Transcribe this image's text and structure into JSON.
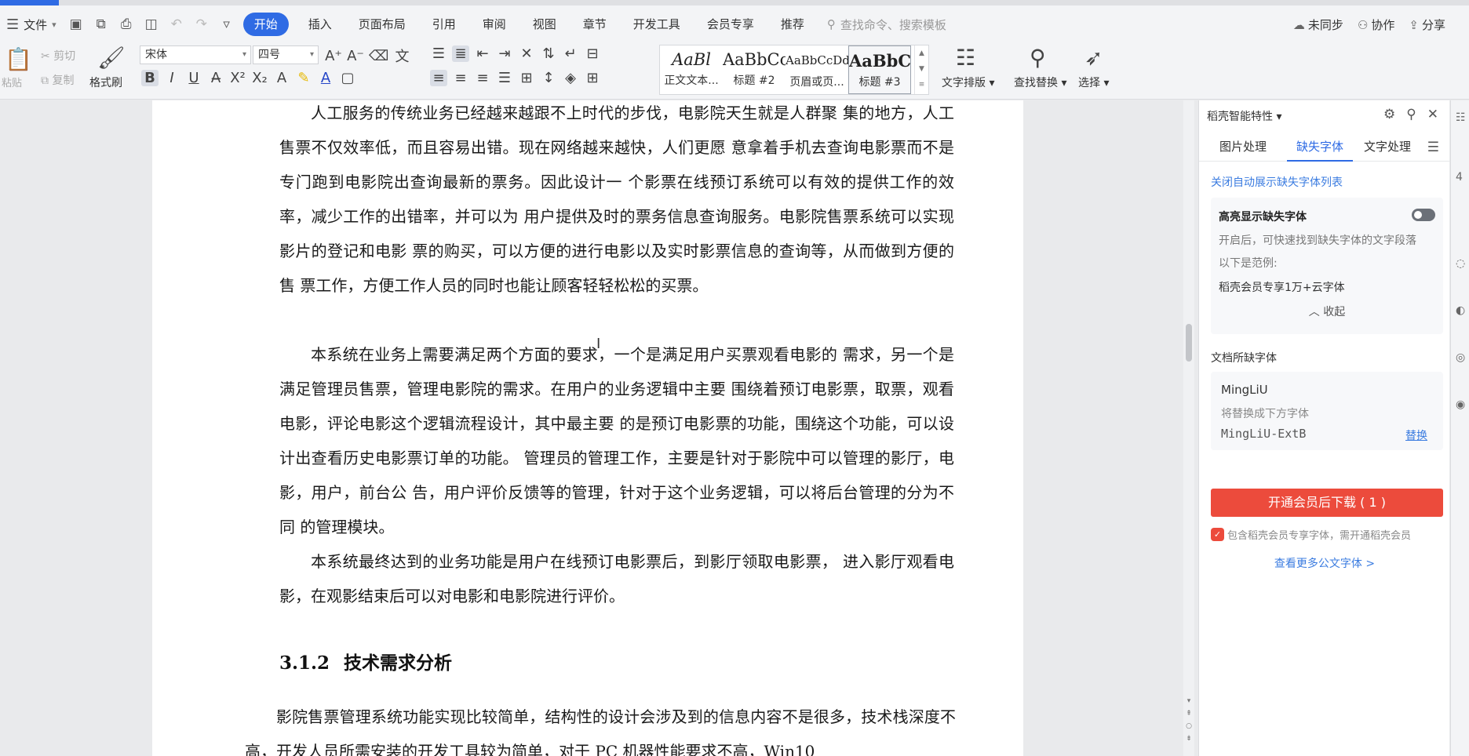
{
  "menubar": {
    "file_label": "文件",
    "tabs": [
      {
        "label": "开始",
        "active": true
      },
      {
        "label": "插入"
      },
      {
        "label": "页面布局"
      },
      {
        "label": "引用"
      },
      {
        "label": "审阅"
      },
      {
        "label": "视图"
      },
      {
        "label": "章节"
      },
      {
        "label": "开发工具"
      },
      {
        "label": "会员专享"
      },
      {
        "label": "推荐"
      }
    ],
    "search_placeholder": "查找命令、搜索模板",
    "sync_label": "未同步",
    "collab_label": "协作",
    "share_label": "分享"
  },
  "ribbon": {
    "paste_label": "粘贴",
    "cut_label": "剪切",
    "copy_label": "复制",
    "format_painter_label": "格式刷",
    "font_name": "宋体",
    "font_size": "四号",
    "styles": [
      {
        "sample": "AaBl",
        "label": "正文文本..."
      },
      {
        "sample": "AaBbCc",
        "label": "标题 #2"
      },
      {
        "sample": "AaBbCcDd",
        "label": "页眉或页..."
      },
      {
        "sample": "AaBbC",
        "label": "标题 #3"
      }
    ],
    "text_layout_label": "文字排版",
    "find_replace_label": "查找替换",
    "select_label": "选择"
  },
  "document": {
    "paragraphs": [
      "人工服务的传统业务已经越来越跟不上时代的步伐，电影院天生就是人群聚 集的地方，人工售票不仅效率低，而且容易出错。现在网络越来越快，人们更愿 意拿着手机去查询电影票而不是专门跑到电影院出查询最新的票务。因此设计一 个影票在线预订系统可以有效的提供工作的效率，减少工作的出错率，并可以为 用户提供及时的票务信息查询服务。电影院售票系统可以实现影片的登记和电影 票的购买，可以方便的进行电影以及实时影票信息的查询等，从而做到方便的售 票工作，方便工作人员的同时也能让顾客轻轻松松的买票。",
      "本系统在业务上需要满足两个方面的要求，一个是满足用户买票观看电影的 需求，另一个是满足管理员售票，管理电影院的需求。在用户的业务逻辑中主要 围绕着预订电影票，取票，观看电影，评论电影这个逻辑流程设计，其中最主要 的是预订电影票的功能，围绕这个功能，可以设计出查看历史电影票订单的功能。 管理员的管理工作，主要是针对于影院中可以管理的影厅，电影，用户，前台公 告，用户评价反馈等的管理，针对于这个业务逻辑，可以将后台管理的分为不同 的管理模块。",
      "本系统最终达到的业务功能是用户在线预订电影票后，到影厅领取电影票， 进入影厅观看电影，在观影结束后可以对电影和电影院进行评价。"
    ],
    "heading_number": "3.1.2",
    "heading_text": "技术需求分析",
    "paragraph4": "影院售票管理系统功能实现比较简单，结构性的设计会涉及到的信息内容不是很多，技术栈深度不高，开发人员所需安装的开发工具较为简单，对于 PC 机器性能要求不高，Win10"
  },
  "panel": {
    "title": "稻壳智能特性",
    "tabs": [
      "图片处理",
      "缺失字体",
      "文字处理"
    ],
    "active_tab": "缺失字体",
    "close_auto_link": "关闭自动展示缺失字体列表",
    "highlight_title": "高亮显示缺失字体",
    "highlight_desc": "开启后，可快速找到缺失字体的文字段落",
    "example_label": "以下是范例:",
    "example_value": "稻壳会员专享1万+云字体",
    "collapse_label": "收起",
    "missing_section": "文档所缺字体",
    "missing_font": "MingLiU",
    "replace_hint": "将替换成下方字体",
    "replacement_font": "MingLiU-ExtB",
    "replace_button": "替换",
    "download_button": "开通会员后下载 ( 1 )",
    "member_note": "包含稻壳会员专享字体，需开通稻壳会员",
    "more_fonts_link": "查看更多公文字体 >"
  },
  "colors": {
    "accent": "#2f6be4",
    "download": "#ec4b3c",
    "link": "#3b7ce0"
  }
}
